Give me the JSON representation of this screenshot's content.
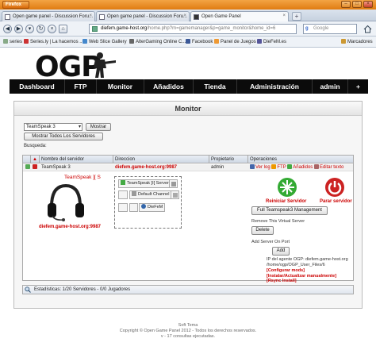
{
  "browser": {
    "app_button": "Firefox",
    "tabs": [
      {
        "label": "Open game panel - Discussion Foru..."
      },
      {
        "label": "Open game panel - Discussion Foru..."
      },
      {
        "label": "Open Game Panel"
      }
    ],
    "url_domain": "diefem.game-host.org",
    "url_path": "/home.php?m=gamemanager&p=game_monitor&home_id=6",
    "search_placeholder": "Google",
    "bookmarks": [
      {
        "label": "series"
      },
      {
        "label": "Series.ly | La hacemos ..."
      },
      {
        "label": "Web Slice Gallery"
      },
      {
        "label": "AlterGaming Online C..."
      },
      {
        "label": "Facebook"
      },
      {
        "label": "Panel de Juegos"
      },
      {
        "label": "DieFeM.es"
      },
      {
        "label": "Marcadores"
      }
    ]
  },
  "logo": {
    "text": "OGP"
  },
  "menu": [
    {
      "label": "Dashboard"
    },
    {
      "label": "FTP"
    },
    {
      "label": "Monitor"
    },
    {
      "label": "Añadidos"
    },
    {
      "label": "Tienda"
    },
    {
      "label": "Administración"
    },
    {
      "label": "admin"
    },
    {
      "label": "+"
    }
  ],
  "monitor": {
    "title": "Monitor",
    "select_value": "TeamSpeak 3",
    "show_button": "Mostrar",
    "show_all_button": "Mostrar Todos Los Servidores",
    "search_label": "Busqueda:",
    "columns": [
      "Nombre del servidor",
      "Direccion",
      "Propietario",
      "Operaciones"
    ],
    "row": {
      "name": "TeamSpeak 3",
      "address": "diefem.game-host.org:9987",
      "owner": "admin",
      "ops": [
        "Ver log",
        "FTP",
        "Añadidos",
        "Editar texto"
      ]
    },
    "details": {
      "ts_title": "TeamSpeak ][ S",
      "address": "diefem.game-host.org:9987",
      "tree": [
        "TeamSpeak ]I[ Server",
        "Default Channel",
        "DieFeM"
      ],
      "restart_label": "Reiniciar Servidor",
      "stop_label": "Parar servidor",
      "manage_button": "Full Teamspeak3 Management",
      "remove_label": "Remove This Virtual Server",
      "delete_button": "Delete",
      "add_label": "Add Server On Port",
      "add_button": "Add",
      "info_ip": "IP del agente OGP: diefem.game-host.org",
      "info_path": "/home/ogp/OGP_User_Files/6",
      "link_config": "[Configurar mods]",
      "link_install": "[Instalar/Actualizar manualmente]",
      "link_rsync": "[Rsync Install]"
    },
    "stats": "Estadísticas: 1/20 Servidores - 0/0 Jugadores"
  },
  "footer": {
    "theme": "Soft Tema",
    "copyright": "Copyright © Open Game Panel 2012 - Todos los derechos reservados.",
    "queries": "v - 17 consultas ejecutadas."
  },
  "colors": {
    "accent_red": "#cc0000",
    "menu_bg": "#0b0b0b",
    "firefox_orange": "#e07c12"
  }
}
